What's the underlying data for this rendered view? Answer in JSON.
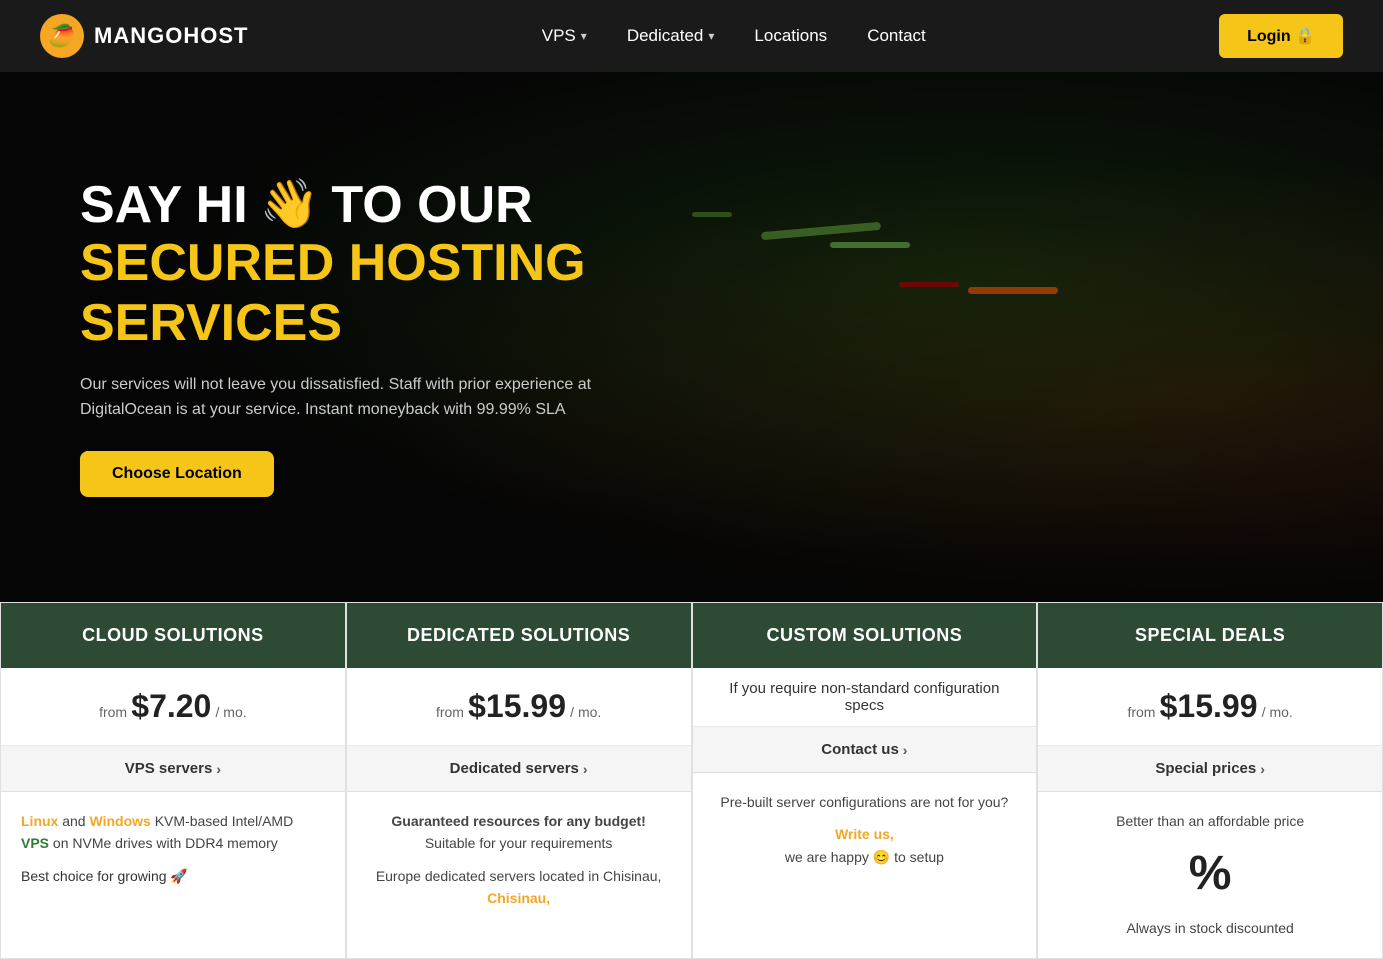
{
  "navbar": {
    "logo_text": "MANGOHOST",
    "logo_emoji": "🥭",
    "nav_items": [
      {
        "label": "VPS",
        "has_dropdown": true
      },
      {
        "label": "Dedicated",
        "has_dropdown": true
      },
      {
        "label": "Locations",
        "has_dropdown": false
      },
      {
        "label": "Contact",
        "has_dropdown": false
      }
    ],
    "login_label": "Login 🔒"
  },
  "hero": {
    "say_hi": "SAY HI",
    "to_our": "TO OUR",
    "wave_emoji": "👋",
    "title_line1": "SECURED HOSTING",
    "title_line2": "SERVICES",
    "description": "Our services will not leave you dissatisfied. Staff with prior experience at DigitalOcean is at your service. Instant moneyback with 99.99% SLA",
    "cta_button": "Choose Location"
  },
  "cards": [
    {
      "id": "cloud",
      "header": "CLOUD SOLUTIONS",
      "from_label": "from",
      "price": "$7.20",
      "per_mo": "/ mo.",
      "link_label": "VPS servers",
      "body_html_parts": {
        "linux": "Linux",
        "and": " and ",
        "windows": "Windows",
        "mid": " KVM-based Intel/AMD ",
        "vps": "VPS",
        "end": " on NVMe drives with DDR4 memory",
        "best_choice": "Best choice for growing 🚀"
      }
    },
    {
      "id": "dedicated",
      "header": "DEDICATED SOLUTIONS",
      "from_label": "from",
      "price": "$15.99",
      "per_mo": "/ mo.",
      "link_label": "Dedicated servers",
      "body_line1": "Guaranteed resources for any budget!",
      "body_line2": "Suitable for your requirements",
      "body_line3": "Europe dedicated servers located in Chisinau,"
    },
    {
      "id": "custom",
      "header": "CUSTOM SOLUTIONS",
      "custom_desc": "If you require non-standard configuration specs",
      "link_label": "Contact us",
      "body_line1": "Pre-built server configurations are not for you?",
      "write_us": "Write us,",
      "body_line2": "we are happy 😊 to setup"
    },
    {
      "id": "special",
      "header": "SPECIAL DEALS",
      "from_label": "from",
      "price": "$15.99",
      "per_mo": "/ mo.",
      "link_label": "Special prices",
      "body_line1": "Better than an affordable price",
      "percent": "%",
      "body_line2": "Always in stock discounted"
    }
  ]
}
